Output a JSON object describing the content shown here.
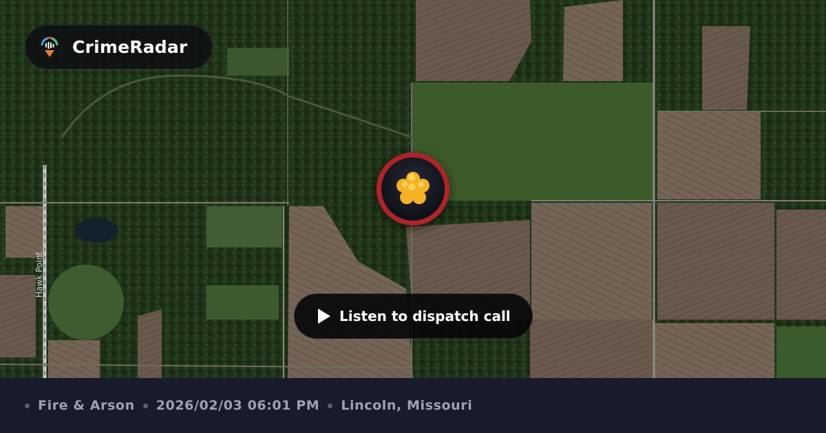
{
  "brand": {
    "name": "CrimeRadar"
  },
  "map": {
    "road_label": "Hawk Point"
  },
  "incident": {
    "category_icon": "fire-icon"
  },
  "actions": {
    "listen_label": "Listen to dispatch call"
  },
  "meta": {
    "category": "Fire & Arson",
    "datetime": "2026/02/03 06:01 PM",
    "location": "Lincoln, Missouri"
  },
  "colors": {
    "marker_ring": "#b0232a",
    "footer_bg": "#171b2c",
    "footer_text": "#9ea3b3"
  }
}
